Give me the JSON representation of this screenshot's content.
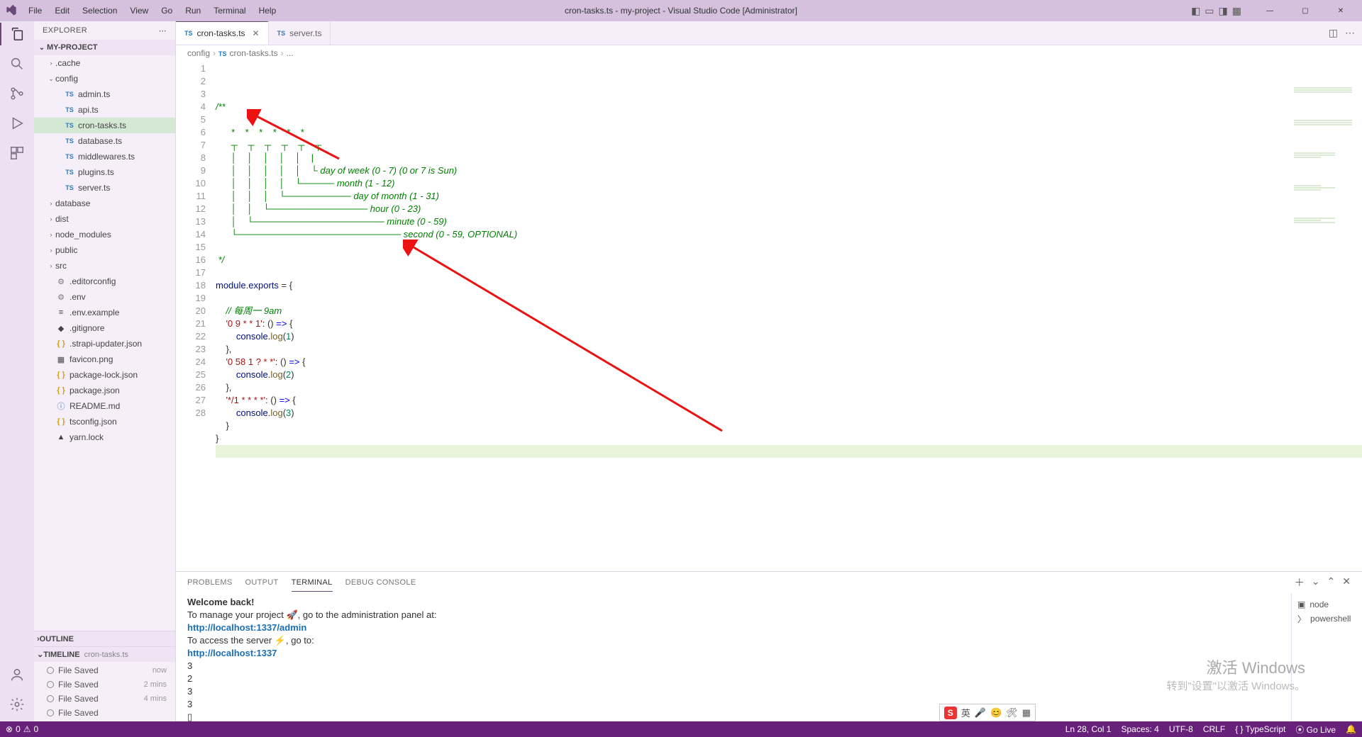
{
  "titlebar": {
    "menus": [
      "File",
      "Edit",
      "Selection",
      "View",
      "Go",
      "Run",
      "Terminal",
      "Help"
    ],
    "title": "cron-tasks.ts - my-project - Visual Studio Code [Administrator]"
  },
  "sidebar": {
    "header": "EXPLORER",
    "project": "MY-PROJECT",
    "tree": [
      {
        "type": "folder",
        "name": ".cache",
        "depth": 1,
        "expanded": false
      },
      {
        "type": "folder",
        "name": "config",
        "depth": 1,
        "expanded": true
      },
      {
        "type": "file",
        "name": "admin.ts",
        "depth": 2,
        "icon": "ts"
      },
      {
        "type": "file",
        "name": "api.ts",
        "depth": 2,
        "icon": "ts"
      },
      {
        "type": "file",
        "name": "cron-tasks.ts",
        "depth": 2,
        "icon": "ts",
        "selected": true
      },
      {
        "type": "file",
        "name": "database.ts",
        "depth": 2,
        "icon": "ts"
      },
      {
        "type": "file",
        "name": "middlewares.ts",
        "depth": 2,
        "icon": "ts"
      },
      {
        "type": "file",
        "name": "plugins.ts",
        "depth": 2,
        "icon": "ts"
      },
      {
        "type": "file",
        "name": "server.ts",
        "depth": 2,
        "icon": "ts"
      },
      {
        "type": "folder",
        "name": "database",
        "depth": 1,
        "expanded": false
      },
      {
        "type": "folder",
        "name": "dist",
        "depth": 1,
        "expanded": false
      },
      {
        "type": "folder",
        "name": "node_modules",
        "depth": 1,
        "expanded": false
      },
      {
        "type": "folder",
        "name": "public",
        "depth": 1,
        "expanded": false
      },
      {
        "type": "folder",
        "name": "src",
        "depth": 1,
        "expanded": false
      },
      {
        "type": "file",
        "name": ".editorconfig",
        "depth": 1,
        "icon": "cfg"
      },
      {
        "type": "file",
        "name": ".env",
        "depth": 1,
        "icon": "cfg"
      },
      {
        "type": "file",
        "name": ".env.example",
        "depth": 1,
        "icon": "txt"
      },
      {
        "type": "file",
        "name": ".gitignore",
        "depth": 1,
        "icon": "git"
      },
      {
        "type": "file",
        "name": ".strapi-updater.json",
        "depth": 1,
        "icon": "json"
      },
      {
        "type": "file",
        "name": "favicon.png",
        "depth": 1,
        "icon": "img"
      },
      {
        "type": "file",
        "name": "package-lock.json",
        "depth": 1,
        "icon": "json"
      },
      {
        "type": "file",
        "name": "package.json",
        "depth": 1,
        "icon": "json"
      },
      {
        "type": "file",
        "name": "README.md",
        "depth": 1,
        "icon": "md"
      },
      {
        "type": "file",
        "name": "tsconfig.json",
        "depth": 1,
        "icon": "json"
      },
      {
        "type": "file",
        "name": "yarn.lock",
        "depth": 1,
        "icon": "lock"
      }
    ],
    "outline": "OUTLINE",
    "timeline": {
      "label": "TIMELINE",
      "sub": "cron-tasks.ts",
      "items": [
        {
          "label": "File Saved",
          "time": "now"
        },
        {
          "label": "File Saved",
          "time": "2 mins"
        },
        {
          "label": "File Saved",
          "time": "4 mins"
        },
        {
          "label": "File Saved",
          "time": ""
        }
      ]
    }
  },
  "tabs": [
    {
      "label": "cron-tasks.ts",
      "icon": "ts",
      "active": true,
      "close": true
    },
    {
      "label": "server.ts",
      "icon": "ts",
      "active": false,
      "close": false
    }
  ],
  "breadcrumb": [
    "config",
    "cron-tasks.ts",
    "..."
  ],
  "editor": {
    "lines": [
      {
        "n": 1,
        "html": "<span class='cm-comment'>/**</span>"
      },
      {
        "n": 2,
        "html": "<span class='cm-comment'></span>"
      },
      {
        "n": 3,
        "html": "<span class='cm-comment'>      *    *    *    *    *    *</span>"
      },
      {
        "n": 4,
        "html": "<span class='cm-comment'>      ┬    ┬    ┬    ┬    ┬    ┬</span>"
      },
      {
        "n": 5,
        "html": "<span class='cm-comment'>      │    │    │    │    │    |</span>"
      },
      {
        "n": 6,
        "html": "<span class='cm-comment'>      │    │    │    │    │    └ day of week (0 - 7) (0 or 7 is Sun)</span>"
      },
      {
        "n": 7,
        "html": "<span class='cm-comment'>      │    │    │    │    └───── month (1 - 12)</span>"
      },
      {
        "n": 8,
        "html": "<span class='cm-comment'>      │    │    │    └────────── day of month (1 - 31)</span>"
      },
      {
        "n": 9,
        "html": "<span class='cm-comment'>      │    │    └─────────────── hour (0 - 23)</span>"
      },
      {
        "n": 10,
        "html": "<span class='cm-comment'>      │    └──────────────────── minute (0 - 59)</span>"
      },
      {
        "n": 11,
        "html": "<span class='cm-comment'>      └───────────────────────── second (0 - 59, OPTIONAL)</span>"
      },
      {
        "n": 12,
        "html": ""
      },
      {
        "n": 13,
        "html": "<span class='cm-comment'> */</span>"
      },
      {
        "n": 14,
        "html": ""
      },
      {
        "n": 15,
        "html": "<span class='cm-var'>module</span><span class='cm-punc'>.</span><span class='cm-var'>exports</span> <span class='cm-punc'>=</span> <span class='cm-punc'>{</span>"
      },
      {
        "n": 16,
        "html": ""
      },
      {
        "n": 17,
        "html": "    <span class='cm-comment'>// 每周一 9am</span>"
      },
      {
        "n": 18,
        "html": "    <span class='cm-str'>'0 9 * * 1'</span><span class='cm-punc'>:</span> <span class='cm-punc'>(</span><span class='cm-punc'>)</span> <span class='cm-arrow'>=&gt;</span> <span class='cm-punc'>{</span>"
      },
      {
        "n": 19,
        "html": "        <span class='cm-var'>console</span><span class='cm-punc'>.</span><span class='cm-fn'>log</span><span class='cm-punc'>(</span><span class='cm-num'>1</span><span class='cm-punc'>)</span>"
      },
      {
        "n": 20,
        "html": "    <span class='cm-punc'>},</span>"
      },
      {
        "n": 21,
        "html": "    <span class='cm-str'>'0 58 1 ? * *'</span><span class='cm-punc'>:</span> <span class='cm-punc'>(</span><span class='cm-punc'>)</span> <span class='cm-arrow'>=&gt;</span> <span class='cm-punc'>{</span>"
      },
      {
        "n": 22,
        "html": "        <span class='cm-var'>console</span><span class='cm-punc'>.</span><span class='cm-fn'>log</span><span class='cm-punc'>(</span><span class='cm-num'>2</span><span class='cm-punc'>)</span>"
      },
      {
        "n": 23,
        "html": "    <span class='cm-punc'>},</span>"
      },
      {
        "n": 24,
        "html": "    <span class='cm-str'>'*/1 * * * *'</span><span class='cm-punc'>:</span> <span class='cm-punc'>(</span><span class='cm-punc'>)</span> <span class='cm-arrow'>=&gt;</span> <span class='cm-punc'>{</span>"
      },
      {
        "n": 25,
        "html": "        <span class='cm-var'>console</span><span class='cm-punc'>.</span><span class='cm-fn'>log</span><span class='cm-punc'>(</span><span class='cm-num'>3</span><span class='cm-punc'>)</span>"
      },
      {
        "n": 26,
        "html": "    <span class='cm-punc'>}</span>"
      },
      {
        "n": 27,
        "html": "<span class='cm-punc'>}</span>"
      },
      {
        "n": 28,
        "html": "",
        "highlight": true
      }
    ]
  },
  "panel": {
    "tabs": [
      "PROBLEMS",
      "OUTPUT",
      "TERMINAL",
      "DEBUG CONSOLE"
    ],
    "activeTab": "TERMINAL",
    "terminal": [
      {
        "cls": "bold",
        "text": "Welcome back!"
      },
      {
        "cls": "",
        "text": "To manage your project 🚀, go to the administration panel at:"
      },
      {
        "cls": "link bold",
        "text": "http://localhost:1337/admin"
      },
      {
        "cls": "",
        "text": ""
      },
      {
        "cls": "",
        "text": "To access the server ⚡, go to:"
      },
      {
        "cls": "link bold",
        "text": "http://localhost:1337"
      },
      {
        "cls": "",
        "text": ""
      },
      {
        "cls": "",
        "text": "3"
      },
      {
        "cls": "",
        "text": "2"
      },
      {
        "cls": "",
        "text": "3"
      },
      {
        "cls": "",
        "text": "3"
      },
      {
        "cls": "",
        "text": "▯"
      }
    ],
    "side": [
      {
        "icon": "▣",
        "label": "node"
      },
      {
        "icon": "〉",
        "label": "powershell"
      }
    ]
  },
  "statusbar": {
    "left": [
      {
        "icon": "⊗",
        "text": "0"
      },
      {
        "icon": "⚠",
        "text": "0"
      }
    ],
    "right": [
      "Ln 28, Col 1",
      "Spaces: 4",
      "UTF-8",
      "CRLF",
      "{ } TypeScript",
      "⦿ Go Live",
      "🔔"
    ]
  },
  "watermark": {
    "big": "激活 Windows",
    "small": "转到\"设置\"以激活 Windows。"
  },
  "ime": {
    "badge": "S",
    "items": [
      "英",
      "🎤",
      "😊",
      "🛠",
      "▦"
    ]
  }
}
